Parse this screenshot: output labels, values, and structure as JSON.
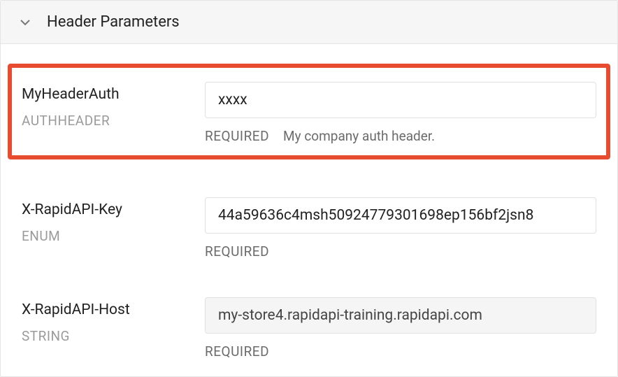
{
  "section": {
    "title": "Header Parameters"
  },
  "params": [
    {
      "name": "MyHeaderAuth",
      "type": "AUTHHEADER",
      "value": "xxxx",
      "required_label": "REQUIRED",
      "description": "My company auth header.",
      "readonly": false,
      "highlighted": true
    },
    {
      "name": "X-RapidAPI-Key",
      "type": "ENUM",
      "value": "44a59636c4msh50924779301698ep156bf2jsn8",
      "required_label": "REQUIRED",
      "description": "",
      "readonly": false,
      "highlighted": false
    },
    {
      "name": "X-RapidAPI-Host",
      "type": "STRING",
      "value": "my-store4.rapidapi-training.rapidapi.com",
      "required_label": "REQUIRED",
      "description": "",
      "readonly": true,
      "highlighted": false
    }
  ]
}
